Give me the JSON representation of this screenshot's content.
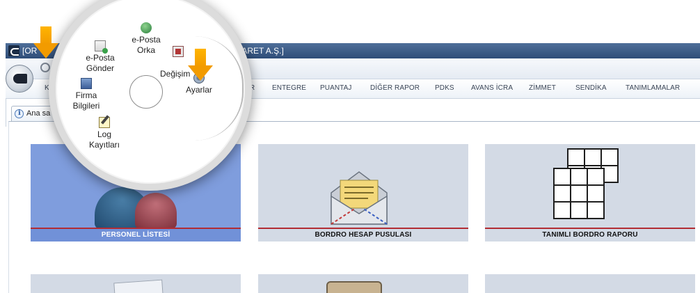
{
  "window": {
    "title_left": "[OR",
    "title_right": "TİCARET A.Ş.]"
  },
  "quickbar": {
    "dropdown": "⁼"
  },
  "ribbon": {
    "tabs": [
      {
        "label": "KA"
      },
      {
        "label": "MLER"
      },
      {
        "label": "ENTEGRE"
      },
      {
        "label": "PUANTAJ"
      },
      {
        "label": "DİĞER RAPOR"
      },
      {
        "label": "PDKS"
      },
      {
        "label": "AVANS İCRA"
      },
      {
        "label": "ZİMMET"
      },
      {
        "label": "SENDİKA"
      },
      {
        "label": "TANIMLAMALAR"
      }
    ]
  },
  "document_tab": {
    "label": "Ana sa"
  },
  "menu": {
    "items": [
      {
        "label_line1": "e-Posta",
        "label_line2": "Orka",
        "icon": "e-posta-orka-icon"
      },
      {
        "label_line1": "e-Posta",
        "label_line2": "Gönder",
        "icon": "mail-send-icon"
      },
      {
        "label_line1": "",
        "label_line2": "Değişim",
        "icon": "password-change-icon"
      },
      {
        "label_line1": "Firma",
        "label_line2": "Bilgileri",
        "icon": "server-icon"
      },
      {
        "label_line1": "Ayarlar",
        "label_line2": "",
        "icon": "gear-icon"
      },
      {
        "label_line1": "Log",
        "label_line2": "Kayıtları",
        "icon": "log-icon"
      }
    ]
  },
  "tiles": [
    {
      "label": "PERSONEL LİSTESİ",
      "active": true
    },
    {
      "label": "BORDRO HESAP PUSULASI",
      "active": false
    },
    {
      "label": "TANIMLI BORDRO RAPORU",
      "active": false
    }
  ],
  "colors": {
    "accent_arrow": "#f29b00",
    "active_tile": "#7f9ddd",
    "tile_bg": "#d3dae5",
    "tile_underline": "#b22c33"
  }
}
